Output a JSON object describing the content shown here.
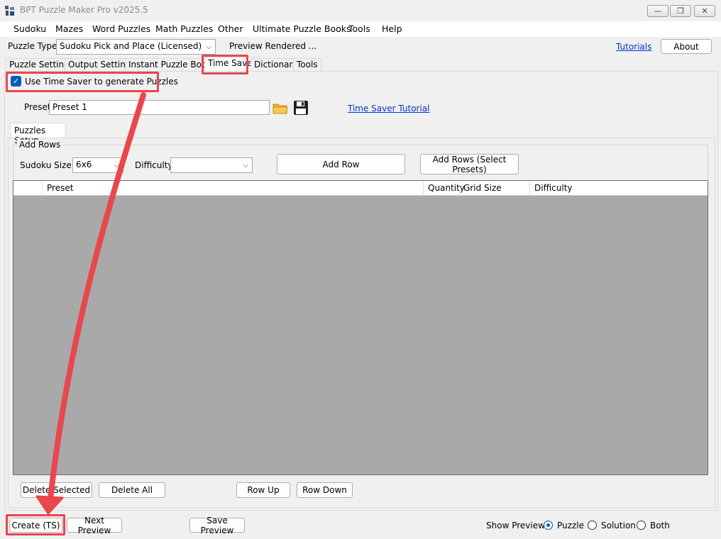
{
  "window": {
    "title": "BPT Puzzle Maker Pro v2025.5"
  },
  "menu": [
    "Sudoku",
    "Mazes",
    "Word Puzzles",
    "Math Puzzles",
    "Other",
    "Ultimate Puzzle Books",
    "Tools",
    "Help"
  ],
  "toolbar": {
    "puzzle_type_label": "Puzzle Type",
    "puzzle_type_value": "Sudoku Pick and Place (Licensed)",
    "preview_status": "Preview Rendered ...",
    "tutorials_link": "Tutorials",
    "about_button": "About"
  },
  "tabs": [
    "Puzzle Settings",
    "Output Settings",
    "Instant Puzzle Books",
    "Time Saver",
    "Dictionary",
    "Tools"
  ],
  "time_saver": {
    "use_checkbox_label": "Use Time Saver to generate Puzzles",
    "use_checkbox_checked": true,
    "preset_label": "Preset",
    "preset_value": "Preset 1",
    "tutorial_link": "Time Saver Tutorial",
    "subtab": "Puzzles Setup",
    "add_rows_group": "Add Rows",
    "sudoku_size_label": "Sudoku Size",
    "sudoku_size_value": "6x6",
    "difficulty_label": "Difficulty",
    "difficulty_value": "",
    "add_row_button": "Add Row",
    "add_rows_presets_button": "Add Rows (Select Presets)"
  },
  "grid": {
    "columns": [
      "",
      "Preset",
      "Quantity",
      "Grid Size",
      "Difficulty"
    ]
  },
  "row_actions": {
    "delete_selected": "Delete Selected",
    "delete_all": "Delete All",
    "row_up": "Row Up",
    "row_down": "Row Down"
  },
  "footer": {
    "create_button": "Create (TS)",
    "next_preview_button": "Next Preview",
    "save_preview_button": "Save Preview",
    "show_preview_label": "Show Preview:",
    "options": [
      "Puzzle",
      "Solution",
      "Both"
    ],
    "selected_option": "Puzzle"
  },
  "colors": {
    "annotation": "#e8474c",
    "accent": "#005fb8",
    "grid_bg": "#a9a9a9"
  }
}
